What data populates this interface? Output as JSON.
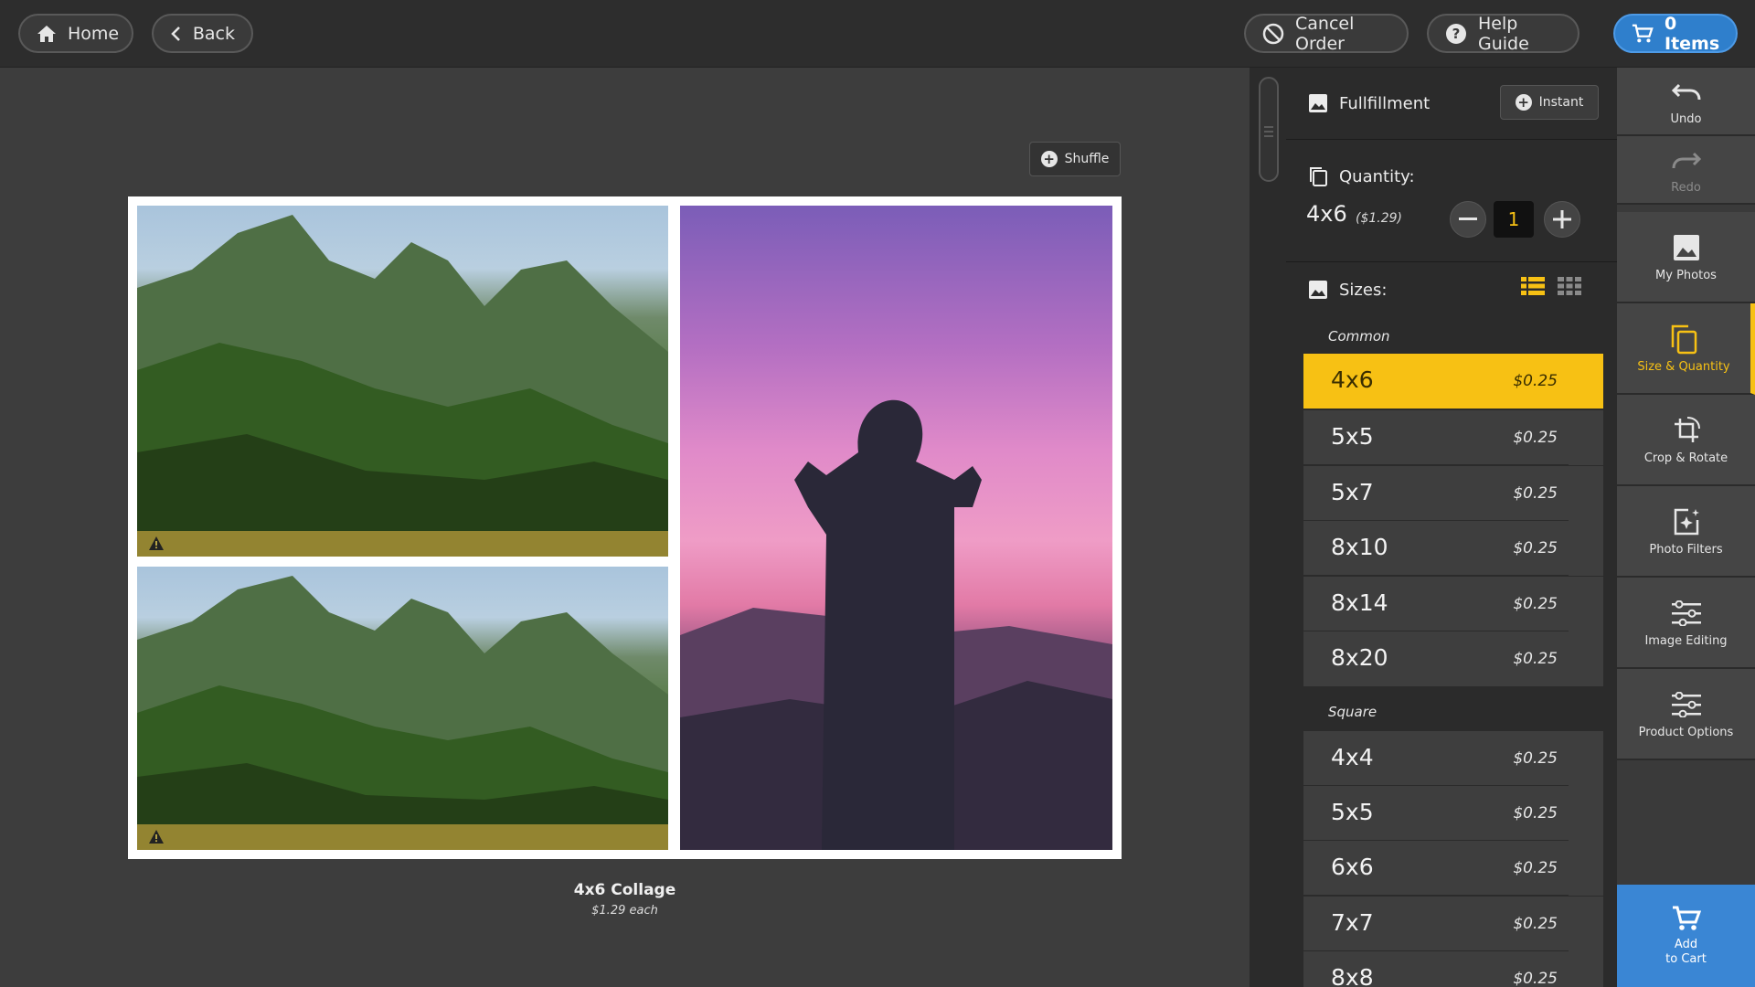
{
  "topbar": {
    "home_label": "Home",
    "back_label": "Back",
    "cancel_label": "Cancel Order",
    "help_label": "Help Guide",
    "cart_label": "0 Items"
  },
  "canvas": {
    "shuffle_label": "Shuffle",
    "product_title": "4x6 Collage",
    "product_price": "$1.29 each"
  },
  "panel": {
    "fulfillment_label": "Fullfillment",
    "instant_label": "Instant",
    "quantity_label": "Quantity:",
    "qty_size": "4x6",
    "qty_price": "($1.29)",
    "qty_value": "1",
    "sizes_label": "Sizes:",
    "common_label": "Common",
    "common_sizes": [
      {
        "label": "4x6",
        "price": "$0.25"
      },
      {
        "label": "5x5",
        "price": "$0.25"
      },
      {
        "label": "5x7",
        "price": "$0.25"
      },
      {
        "label": "8x10",
        "price": "$0.25"
      },
      {
        "label": "8x14",
        "price": "$0.25"
      },
      {
        "label": "8x20",
        "price": "$0.25"
      }
    ],
    "square_label": "Square",
    "square_sizes": [
      {
        "label": "4x4",
        "price": "$0.25"
      },
      {
        "label": "5x5",
        "price": "$0.25"
      },
      {
        "label": "6x6",
        "price": "$0.25"
      },
      {
        "label": "7x7",
        "price": "$0.25"
      },
      {
        "label": "8x8",
        "price": "$0.25"
      }
    ],
    "selected_size": "4x6"
  },
  "rail": {
    "undo": "Undo",
    "redo": "Redo",
    "my_photos": "My Photos",
    "size_quantity": "Size & Quantity",
    "crop_rotate": "Crop & Rotate",
    "photo_filters": "Photo Filters",
    "image_editing": "Image Editing",
    "product_options": "Product Options",
    "add_to_cart_line1": "Add",
    "add_to_cart_line2": "to Cart"
  },
  "colors": {
    "accent": "#f7c114",
    "cart_blue": "#2f7fcc"
  }
}
